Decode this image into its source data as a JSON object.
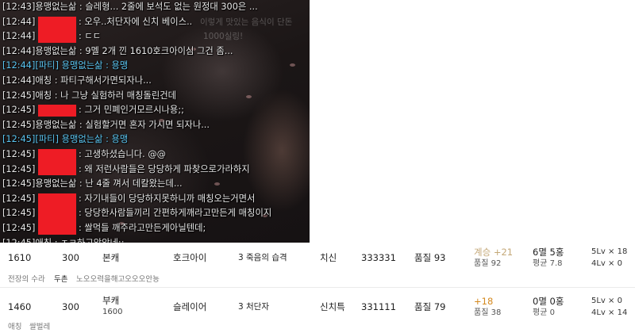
{
  "chat": {
    "bg_note": [
      "이렇게 맛있는 음식이 단돈",
      "1000실링!"
    ],
    "lines": [
      {
        "time": "[12:43]",
        "name": "용맹없는삶",
        "text": " : 슬레형... 2줄에 보석도 없는 원정대 300은 ...",
        "type": "normal",
        "redacted": false
      },
      {
        "time": "[12:44]",
        "name": "",
        "text": ": 오우..처단자에 신치 베이스..",
        "type": "normal",
        "redacted": true
      },
      {
        "time": "[12:44]",
        "name": "",
        "text": ": ㄷㄷ",
        "type": "normal",
        "redacted": true
      },
      {
        "time": "[12:44]",
        "name": "용맹없는삶",
        "text": " : 9멜 2개 낀 1610호크아이심 그건 좀...",
        "type": "normal",
        "redacted": false
      },
      {
        "time": "[12:44]",
        "name": "[파티] 용맹없는삶",
        "text": " : 용맹",
        "type": "party",
        "redacted": false
      },
      {
        "time": "[12:44]",
        "name": "애칭",
        "text": " : 파티구해서가면되자나...",
        "type": "normal",
        "redacted": false
      },
      {
        "time": "[12:45]",
        "name": "애칭",
        "text": " : 나 그냥 실험하러 매칭돌린건데",
        "type": "normal",
        "redacted": false
      },
      {
        "time": "[12:45]",
        "name": "",
        "text": ": 그거 민폐인거모르시나용;;",
        "type": "normal",
        "redacted": true
      },
      {
        "time": "[12:45]",
        "name": "용맹없는삶",
        "text": " : 실험할거면 혼자 가시면 되자나...",
        "type": "normal",
        "redacted": false
      },
      {
        "time": "[12:45]",
        "name": "[파티] 용맹없는삶",
        "text": " : 용맹",
        "type": "party",
        "redacted": false
      },
      {
        "time": "[12:45]",
        "name": "",
        "text": ": 고생하셨습니다. @@",
        "type": "normal",
        "redacted": true
      },
      {
        "time": "[12:45]",
        "name": "",
        "text": ": 왜 저런사람들은 당당하게 파찾으로가라하지",
        "type": "normal",
        "redacted": true
      },
      {
        "time": "[12:45]",
        "name": "용맹없는삶",
        "text": " : 난 4줄 껴서 데칼왔는데...",
        "type": "normal",
        "redacted": false
      },
      {
        "time": "[12:45]",
        "name": "",
        "text": ": 자기내들이 당당하지못하니까 매칭오는거면서",
        "type": "normal",
        "redacted": true
      },
      {
        "time": "[12:45]",
        "name": "",
        "text": ": 당당한사람들끼리 간편하게깨라고만든게 매칭이지",
        "type": "normal",
        "redacted": true
      },
      {
        "time": "[12:45]",
        "name": "",
        "text": ": 쌀먹들 깨주라고만든게아닐텐데;",
        "type": "normal",
        "redacted": true
      },
      {
        "time": "[12:45]",
        "name": "애칭",
        "text": " : ㅈㄹ하고앉았네;;",
        "type": "normal",
        "redacted": false
      }
    ]
  },
  "rows": [
    {
      "ilvl": "1610",
      "honor": "300",
      "char_type": "본캐",
      "char_sub": "",
      "class_name": "호크아이",
      "engraving": "3 죽음의 습격",
      "stats": "치신",
      "stat_values": "333331",
      "quality": "품질 93",
      "refine": "계승 +21",
      "refine_sub": "품질 92",
      "gems": "6멸 5홍",
      "gems_sub": "평균 7.8",
      "lv5": "5Lv × 18",
      "lv4": "4Lv × 0",
      "mini": [
        "전장의 수라",
        "두촌",
        "노오오력을해고오오오안뇽"
      ]
    },
    {
      "ilvl": "1460",
      "honor": "300",
      "char_type": "부캐",
      "char_sub": "1600",
      "class_name": "슬레이어",
      "engraving": "3 처단자",
      "stats": "신치특",
      "stat_values": "331111",
      "quality": "품질 79",
      "refine": "+18",
      "refine_sub": "품질 38",
      "gems": "0멸 0홍",
      "gems_sub": "평균 0",
      "lv5": "5Lv × 0",
      "lv4": "4Lv × 14",
      "mini": [
        "애칭",
        "쌀벌레"
      ]
    }
  ],
  "colors": {
    "party_chat": "#5cc6f2",
    "redaction": "#ee1c25",
    "refine_gold": "#c4a878",
    "refine_orange": "#d4891f"
  }
}
